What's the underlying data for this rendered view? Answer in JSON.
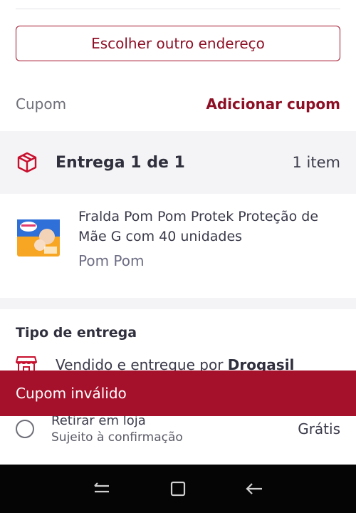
{
  "address": {
    "choose_other_label": "Escolher outro endereço"
  },
  "coupon": {
    "label": "Cupom",
    "add_label": "Adicionar cupom"
  },
  "delivery": {
    "title": "Entrega 1 de 1",
    "count": "1 item"
  },
  "product": {
    "name": "Fralda Pom Pom Protek Proteção de Mãe G com 40 unidades",
    "brand": "Pom Pom",
    "image_icon": "diaper-package-image"
  },
  "delivery_type": {
    "title": "Tipo de entrega",
    "sold_by_prefix": "Vendido e entregue por ",
    "sold_by_store": "Drogasil",
    "pickup": {
      "title": "Retirar em loja",
      "subtitle": "Sujeito à confirmação",
      "price": "Grátis"
    }
  },
  "toast": {
    "message": "Cupom inválido"
  },
  "colors": {
    "brand": "#8d0f25",
    "toast_bg": "#a5102a",
    "section_bg": "#f4f4f6",
    "nav_bg": "#050505"
  },
  "nav_icons": [
    "recent-apps-icon",
    "home-icon",
    "back-icon"
  ]
}
